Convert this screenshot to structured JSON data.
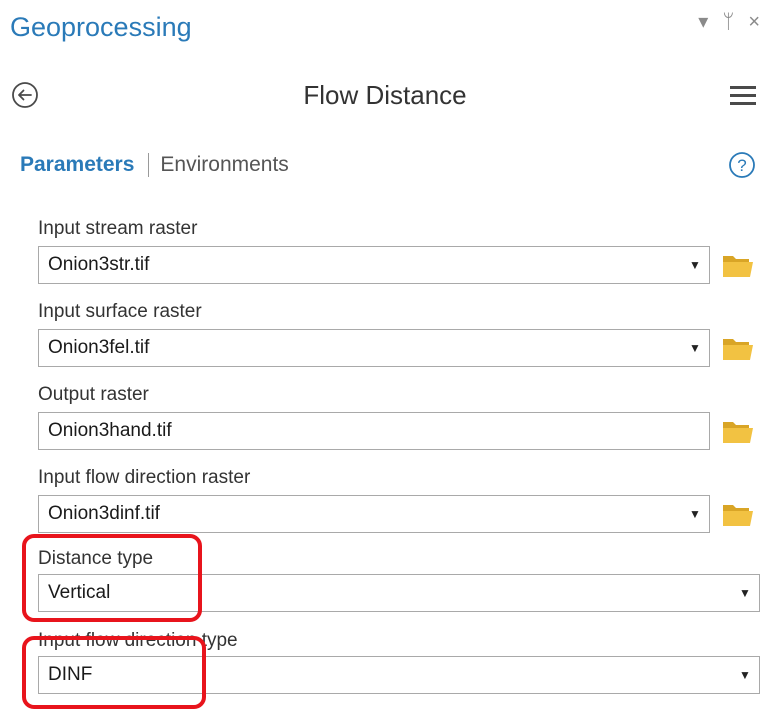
{
  "pane": {
    "title": "Geoprocessing",
    "controls": {
      "dropdown_glyph": "▾",
      "pin_glyph": "ᛘ",
      "close_glyph": "×"
    }
  },
  "tool": {
    "title": "Flow Distance"
  },
  "tabs": {
    "active": "Parameters",
    "inactive": "Environments"
  },
  "parameters": [
    {
      "label": "Input stream raster",
      "value": "Onion3str.tif"
    },
    {
      "label": "Input surface raster",
      "value": "Onion3fel.tif"
    },
    {
      "label": "Output raster",
      "value": "Onion3hand.tif"
    },
    {
      "label": "Input flow direction raster",
      "value": "Onion3dinf.tif"
    },
    {
      "label": "Distance type",
      "value": "Vertical"
    },
    {
      "label": "Input flow direction type",
      "value": "DINF"
    }
  ],
  "colors": {
    "accent": "#2a7ab8",
    "highlight": "#e8141c",
    "folder": "#f2c242"
  },
  "icons": {
    "back": "back-arrow-icon",
    "menu": "hamburger-menu-icon",
    "help": "help-question-icon",
    "browse": "folder-icon",
    "dropdown": "chevron-down-icon"
  }
}
